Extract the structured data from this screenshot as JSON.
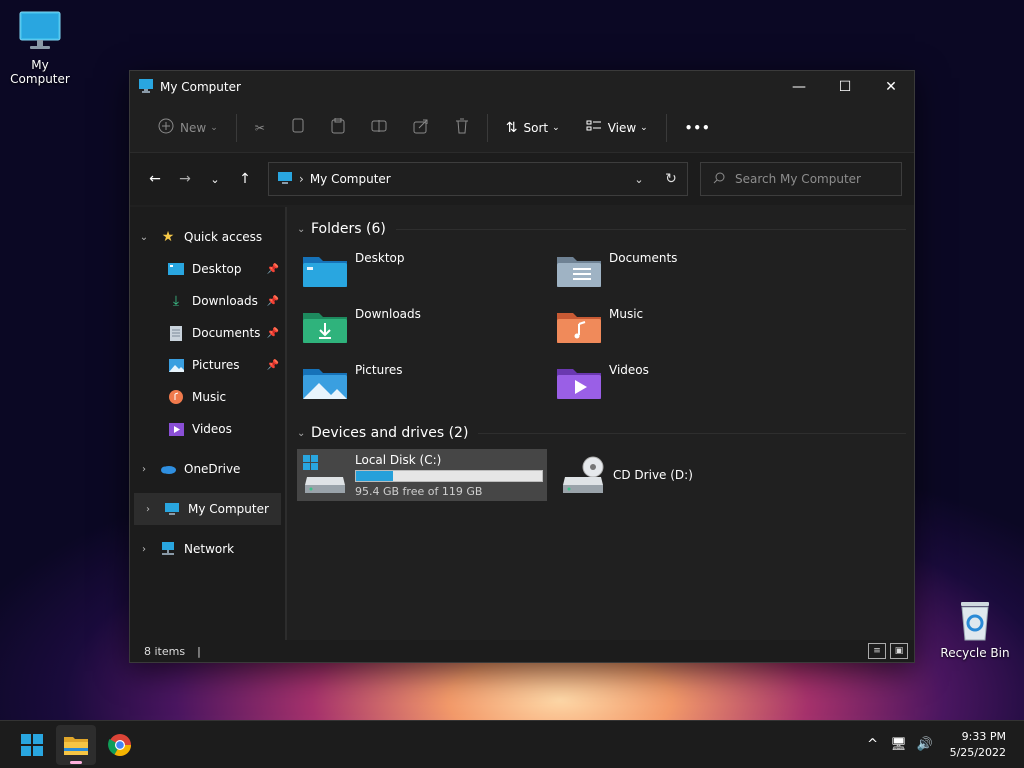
{
  "desktop": {
    "icons": [
      {
        "label": "My Computer",
        "icon": "monitor-icon"
      },
      {
        "label": "Recycle Bin",
        "icon": "recycle-bin-icon"
      }
    ]
  },
  "window": {
    "title": "My Computer",
    "controls": {
      "minimize": "—",
      "maximize": "☐",
      "close": "✕"
    },
    "toolbar": {
      "new_label": "New",
      "sort_label": "Sort",
      "view_label": "View",
      "more_label": "•••"
    },
    "address": {
      "location": "My Computer",
      "separator": "›"
    },
    "search": {
      "placeholder": "Search My Computer"
    },
    "sidebar": {
      "quick_access": "Quick access",
      "pinned": [
        {
          "label": "Desktop",
          "icon": "desktop-folder-icon",
          "pinned": true
        },
        {
          "label": "Downloads",
          "icon": "download-arrow-icon",
          "pinned": true
        },
        {
          "label": "Documents",
          "icon": "document-icon",
          "pinned": true
        },
        {
          "label": "Pictures",
          "icon": "picture-icon",
          "pinned": true
        },
        {
          "label": "Music",
          "icon": "music-icon",
          "pinned": false
        },
        {
          "label": "Videos",
          "icon": "video-icon",
          "pinned": false
        }
      ],
      "onedrive": "OneDrive",
      "my_computer": "My Computer",
      "network": "Network"
    },
    "main": {
      "folders_header": "Folders (6)",
      "folders": [
        {
          "label": "Desktop",
          "icon": "desktop-folder-icon",
          "color": "#1e90d8"
        },
        {
          "label": "Documents",
          "icon": "documents-folder-icon",
          "color": "#8aa3b8"
        },
        {
          "label": "Downloads",
          "icon": "downloads-folder-icon",
          "color": "#2aa876"
        },
        {
          "label": "Music",
          "icon": "music-folder-icon",
          "color": "#f07a4c"
        },
        {
          "label": "Pictures",
          "icon": "pictures-folder-icon",
          "color": "#3a9fe0"
        },
        {
          "label": "Videos",
          "icon": "videos-folder-icon",
          "color": "#8a4fd6"
        }
      ],
      "drives_header": "Devices and drives (2)",
      "drives": [
        {
          "label": "Local Disk (C:)",
          "free_text": "95.4 GB free of 119 GB",
          "used_fraction": 0.2,
          "icon": "hard-drive-icon"
        },
        {
          "label": "CD Drive (D:)",
          "icon": "cd-drive-icon"
        }
      ]
    },
    "status": {
      "items": "8 items",
      "cursor": "|"
    }
  },
  "taskbar": {
    "apps": [
      {
        "name": "start",
        "icon": "windows-start-icon"
      },
      {
        "name": "file-explorer",
        "icon": "file-explorer-icon"
      },
      {
        "name": "chrome",
        "icon": "chrome-icon"
      }
    ],
    "tray": {
      "chevron": "^",
      "network": "🖥",
      "volume": "🔊"
    },
    "time": "9:33 PM",
    "date": "5/25/2022"
  },
  "colors": {
    "accent": "#26a0da",
    "window_bg": "#202020",
    "selected_bg": "#464646"
  }
}
